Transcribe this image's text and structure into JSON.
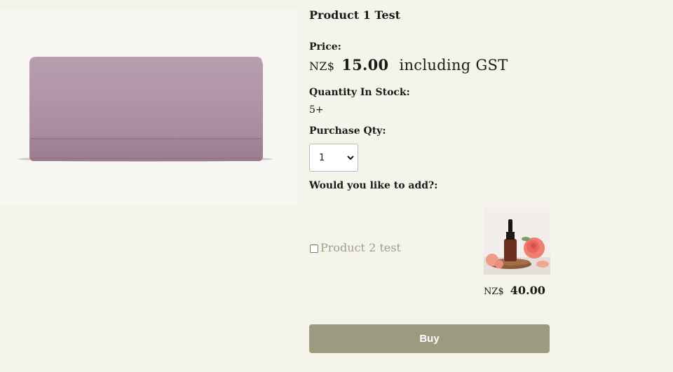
{
  "product": {
    "title": "Product 1 Test",
    "image_icon": "purse-image",
    "price_label": "Price:",
    "currency": "NZ$",
    "price": "15.00",
    "tax_note": "including GST",
    "stock_label": "Quantity In Stock:",
    "stock_value": "5+",
    "qty_label": "Purchase Qty:",
    "qty_value": "1"
  },
  "addon": {
    "prompt": "Would you like to add?:",
    "name": "Product 2 test",
    "image_icon": "serum-bottle-with-roses-image",
    "currency": "NZ$",
    "price": "40.00"
  },
  "actions": {
    "buy_label": "Buy"
  },
  "colors": {
    "background": "#f4f4ea",
    "accent": "#9c9b80",
    "muted_text": "#a19e8a"
  }
}
